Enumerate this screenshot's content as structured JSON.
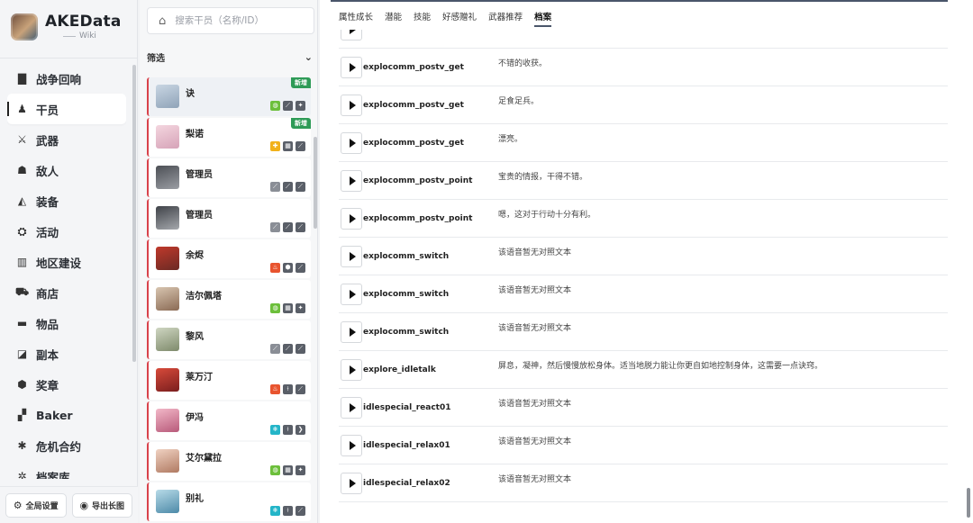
{
  "brand": {
    "title": "AKEData",
    "subtitle": "Wiki"
  },
  "nav": {
    "items": [
      {
        "label": "战争回响",
        "icon": "book-icon",
        "glyph": "▇"
      },
      {
        "label": "干员",
        "icon": "operator-icon",
        "glyph": "♟",
        "active": true
      },
      {
        "label": "武器",
        "icon": "sword-icon",
        "glyph": "⚔"
      },
      {
        "label": "敌人",
        "icon": "enemy-icon",
        "glyph": "☗"
      },
      {
        "label": "装备",
        "icon": "equipment-icon",
        "glyph": "◭"
      },
      {
        "label": "活动",
        "icon": "activity-icon",
        "glyph": "⛭"
      },
      {
        "label": "地区建设",
        "icon": "building-icon",
        "glyph": "▥"
      },
      {
        "label": "商店",
        "icon": "shop-icon",
        "glyph": "⛟"
      },
      {
        "label": "物品",
        "icon": "bag-icon",
        "glyph": "▬"
      },
      {
        "label": "副本",
        "icon": "dungeon-icon",
        "glyph": "◪"
      },
      {
        "label": "奖章",
        "icon": "medal-icon",
        "glyph": "⬢"
      },
      {
        "label": "Baker",
        "icon": "puzzle-icon",
        "glyph": "▞"
      },
      {
        "label": "危机合约",
        "icon": "crisis-icon",
        "glyph": "✱"
      },
      {
        "label": "档案库",
        "icon": "archive-icon",
        "glyph": "✲"
      }
    ],
    "bottom": [
      {
        "label": "全局设置",
        "icon": "gear-icon",
        "glyph": "⚙"
      },
      {
        "label": "导出长图",
        "icon": "camera-icon",
        "glyph": "◉"
      }
    ]
  },
  "list": {
    "search_placeholder": "搜索干员（名称/ID）",
    "filter_label": "筛选",
    "operators": [
      {
        "name": "诀",
        "new": "新增",
        "selected": true,
        "avatar": [
          "#c9d6e3",
          "#8fa3b8"
        ],
        "badges": [
          "#6cbf3b",
          "#5a5f68",
          "#5a5f68"
        ],
        "glyphs": [
          "◍",
          "⟋",
          "✦"
        ]
      },
      {
        "name": "梨诺",
        "new": "新增",
        "avatar": [
          "#f4d6df",
          "#d6a3b8"
        ],
        "badges": [
          "#f1b11a",
          "#5a5f68",
          "#5a5f68"
        ],
        "glyphs": [
          "✚",
          "▦",
          "⟋"
        ]
      },
      {
        "name": "管理员",
        "avatar": [
          "#4c4f55",
          "#9b9ea4"
        ],
        "badges": [
          "#8a8e96",
          "#5a5f68",
          "#5a5f68"
        ],
        "glyphs": [
          "⟋",
          "⟋",
          "⟋"
        ]
      },
      {
        "name": "管理员",
        "avatar": [
          "#3f4248",
          "#a5a8ad"
        ],
        "badges": [
          "#8a8e96",
          "#5a5f68",
          "#5a5f68"
        ],
        "glyphs": [
          "⟋",
          "⟋",
          "⟋"
        ]
      },
      {
        "name": "余烬",
        "avatar": [
          "#c0392b",
          "#6b2a24"
        ],
        "badges": [
          "#e8542f",
          "#5a5f68",
          "#5a5f68"
        ],
        "glyphs": [
          "♨",
          "⬢",
          "⟋"
        ]
      },
      {
        "name": "洁尔佩塔",
        "avatar": [
          "#d8c5b0",
          "#8a6a54"
        ],
        "badges": [
          "#6cbf3b",
          "#5a5f68",
          "#5a5f68"
        ],
        "glyphs": [
          "◍",
          "▦",
          "✦"
        ]
      },
      {
        "name": "黎风",
        "avatar": [
          "#cfd6c2",
          "#7e8a6b"
        ],
        "badges": [
          "#8a8e96",
          "#5a5f68",
          "#5a5f68"
        ],
        "glyphs": [
          "⟋",
          "⟋",
          "⟋"
        ]
      },
      {
        "name": "莱万汀",
        "avatar": [
          "#d84a3a",
          "#7a1e1e"
        ],
        "badges": [
          "#e8542f",
          "#5a5f68",
          "#5a5f68"
        ],
        "glyphs": [
          "♨",
          "⟊",
          "⟋"
        ]
      },
      {
        "name": "伊冯",
        "avatar": [
          "#f2b8c8",
          "#b85a7a"
        ],
        "badges": [
          "#24b5c8",
          "#5a5f68",
          "#5a5f68"
        ],
        "glyphs": [
          "❄",
          "⟊",
          "❯"
        ]
      },
      {
        "name": "艾尔黛拉",
        "avatar": [
          "#f0d2c2",
          "#b07a62"
        ],
        "badges": [
          "#6cbf3b",
          "#5a5f68",
          "#5a5f68"
        ],
        "glyphs": [
          "◍",
          "▦",
          "✦"
        ]
      },
      {
        "name": "别礼",
        "avatar": [
          "#b8dbe8",
          "#4d8aa8"
        ],
        "badges": [
          "#24b5c8",
          "#5a5f68",
          "#5a5f68"
        ],
        "glyphs": [
          "❄",
          "⟊",
          "⟋"
        ]
      }
    ]
  },
  "main": {
    "tabs": [
      "属性成长",
      "潜能",
      "技能",
      "好感赠礼",
      "武器推荐",
      "档案"
    ],
    "active_tab": "档案",
    "rows": [
      {
        "name": "explocomm_postv_get",
        "text": "不错的收获。"
      },
      {
        "name": "explocomm_postv_get",
        "text": "足食足兵。"
      },
      {
        "name": "explocomm_postv_get",
        "text": "漂亮。"
      },
      {
        "name": "explocomm_postv_point",
        "text": "宝贵的情报，干得不错。"
      },
      {
        "name": "explocomm_postv_point",
        "text": "嗯，这对于行动十分有利。"
      },
      {
        "name": "explocomm_switch",
        "text": "该语音暂无对照文本"
      },
      {
        "name": "explocomm_switch",
        "text": "该语音暂无对照文本"
      },
      {
        "name": "explocomm_switch",
        "text": "该语音暂无对照文本"
      },
      {
        "name": "explore_idletalk",
        "text": "屏息，凝神，然后慢慢放松身体。适当地脱力能让你更自如地控制身体，这需要一点诀窍。"
      },
      {
        "name": "idlespecial_react01",
        "text": "该语音暂无对照文本"
      },
      {
        "name": "idlespecial_relax01",
        "text": "该语音暂无对照文本"
      },
      {
        "name": "idlespecial_relax02",
        "text": "该语音暂无对照文本"
      }
    ]
  },
  "colors": {
    "accent": "#4a566a",
    "rarity_bar": "#d9434b",
    "new_badge": "#2e9b57"
  }
}
